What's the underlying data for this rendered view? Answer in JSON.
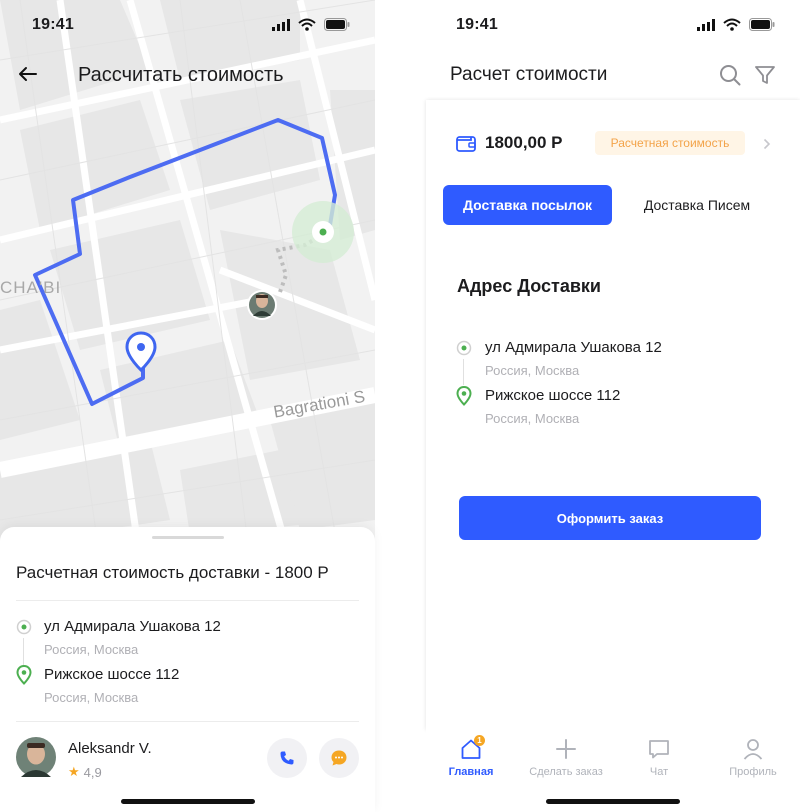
{
  "left": {
    "status_time": "19:41",
    "title": "Рассчитать стоимость",
    "map": {
      "district_label": "CHA'BI",
      "street_label": "Bagrationi S"
    },
    "sheet": {
      "title": "Расчетная стоимость доставки - 1800 Р",
      "from_address": "ул Адмирала Ушакова 12",
      "from_sub": "Россия, Москва",
      "to_address": "Рижское шоссе 112",
      "to_sub": "Россия, Москва",
      "courier_name": "Aleksandr V.",
      "courier_rating": "4,9"
    }
  },
  "right": {
    "status_time": "19:41",
    "title": "Расчет стоимости",
    "price": "1800,00 Р",
    "price_badge": "Расчетная стоимость",
    "tabs": [
      {
        "label": "Доставка посылок",
        "active": true
      },
      {
        "label": "Доставка Писем",
        "active": false
      }
    ],
    "section_title": "Адрес Доставки",
    "from_address": "ул Адмирала Ушакова 12",
    "from_sub": "Россия, Москва",
    "to_address": "Рижское шоссе 112",
    "to_sub": "Россия, Москва",
    "order_button": "Оформить заказ",
    "nav": [
      {
        "label": "Главная",
        "icon": "home-icon",
        "active": true,
        "badge": "1"
      },
      {
        "label": "Сделать заказ",
        "icon": "plus-icon",
        "active": false
      },
      {
        "label": "Чат",
        "icon": "chat-icon",
        "active": false
      },
      {
        "label": "Профиль",
        "icon": "profile-icon",
        "active": false
      }
    ]
  },
  "colors": {
    "accent": "#2F5BFF",
    "green": "#4CAF50",
    "badge_text": "#F3A349",
    "badge_bg": "#FFF5E6"
  }
}
